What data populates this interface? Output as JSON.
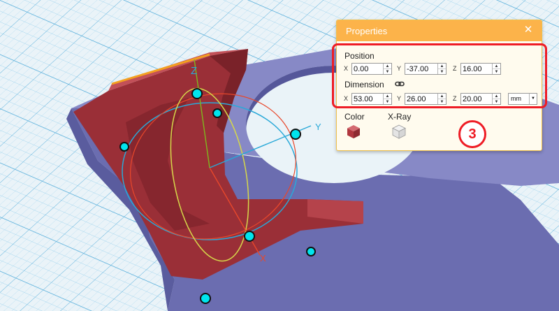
{
  "colors": {
    "panel_header": "#fcb34a",
    "panel_body": "#fffbee",
    "highlight": "#ee1c25",
    "grid_background": "#e9f1f6",
    "grid_lines": "#7ec3e6",
    "base_part": "#7d7fbd",
    "selected_part": "#a5363d",
    "gizmo_handles": "#00e5ee"
  },
  "viewport": {
    "gizmo_labels": {
      "z": "Z",
      "y": "Y",
      "x": "X"
    }
  },
  "properties": {
    "title": "Properties",
    "close_icon": "close-icon",
    "position": {
      "label": "Position",
      "x": {
        "axis": "X",
        "value": "0.00"
      },
      "y": {
        "axis": "Y",
        "value": "-37.00"
      },
      "z": {
        "axis": "Z",
        "value": "16.00"
      }
    },
    "dimension": {
      "label": "Dimension",
      "lock_icon": "link-icon",
      "x": {
        "axis": "X",
        "value": "53.00"
      },
      "y": {
        "axis": "Y",
        "value": "26.00"
      },
      "z": {
        "axis": "Z",
        "value": "20.00"
      },
      "unit": "mm"
    },
    "display_modes": [
      {
        "label": "Color",
        "icon": "color-cube-icon"
      },
      {
        "label": "X-Ray",
        "icon": "xray-cube-icon"
      }
    ]
  },
  "callout": {
    "number": "3"
  }
}
